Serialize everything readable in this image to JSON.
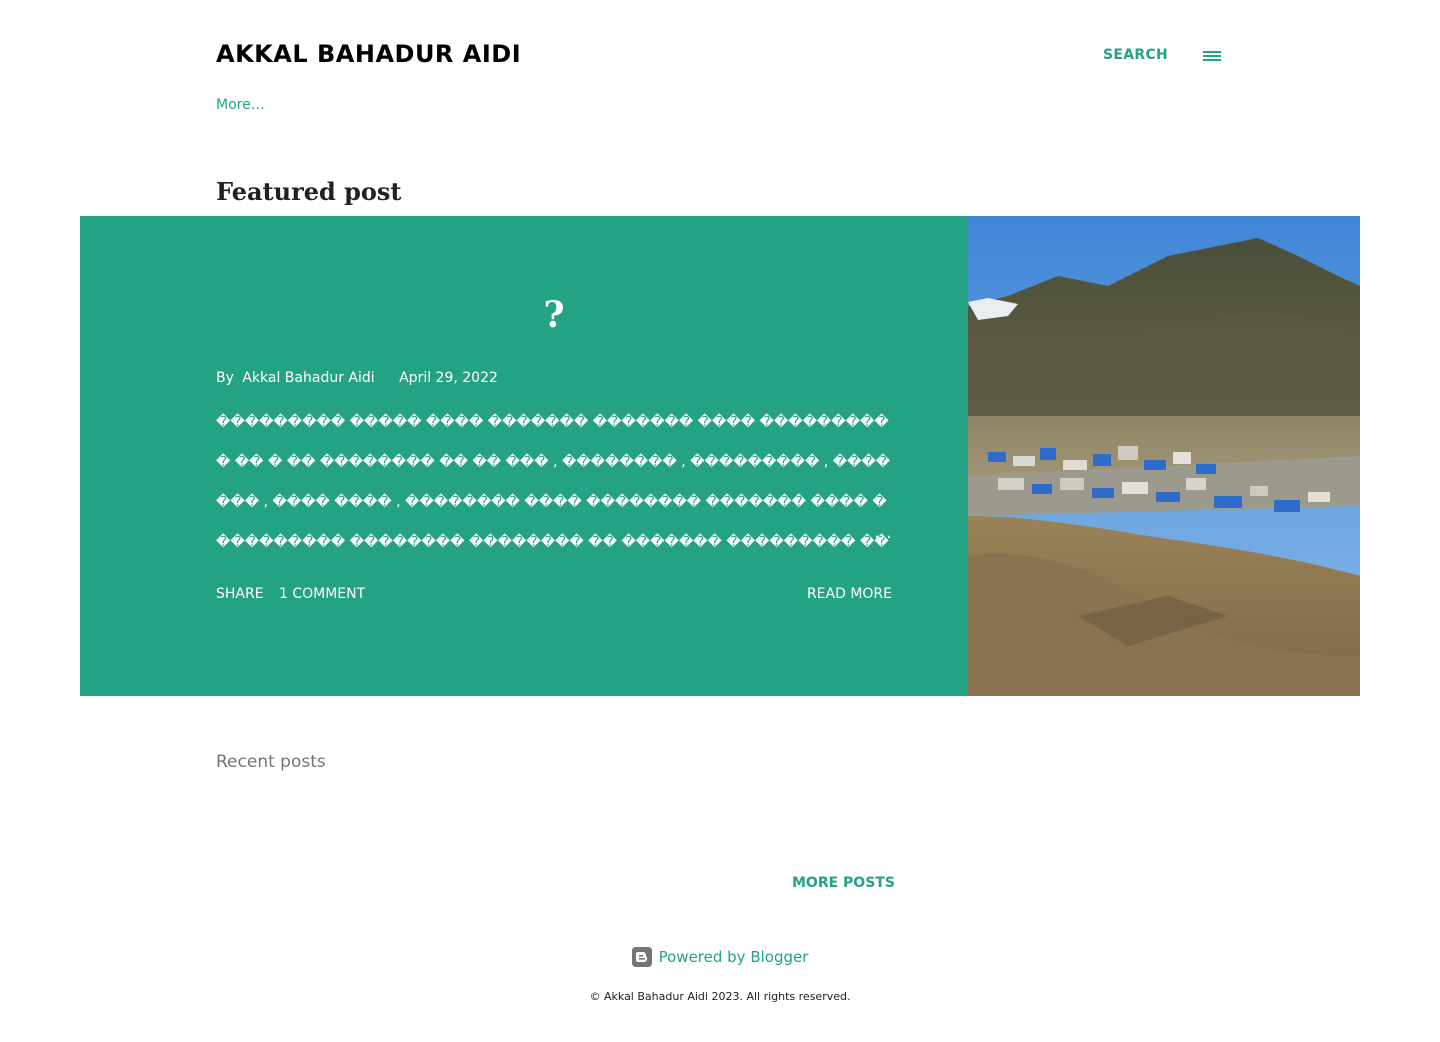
{
  "header": {
    "blog_title": "AKKAL BAHADUR AIDI",
    "search_label": "SEARCH",
    "menu_icon": "hamburger-menu-icon"
  },
  "nav": {
    "more_label": "More…"
  },
  "featured": {
    "section_heading": "Featured post",
    "post_title": "?",
    "byline_prefix": "By",
    "author": "Akkal Bahadur Aidi",
    "date": "April 29, 2022",
    "snippet": " ��������� ����� ���� ������� ������� ���� ���������� �� � �� �������� �� �� ��� , �������� , ��������� , ������� , ���� ���� , �������� ���� �������� ������� ���� ���������� �������� �������� �� ������� ��������� ���������� ����� ������� ����� ���� , ����� , �������� , ��������� ,",
    "ellipsis": "…",
    "share_label": "SHARE",
    "comments_label": "1 COMMENT",
    "read_more_label": "READ MORE",
    "image_alt": "mountain-village-photo"
  },
  "recent": {
    "heading": "Recent posts",
    "more_posts_label": "MORE POSTS"
  },
  "footer": {
    "powered_by": "Powered by Blogger",
    "copyright": "© Akkal Bahadur Aidi 2023. All rights reserved."
  },
  "colors": {
    "accent": "#24a384",
    "text": "#212121",
    "muted": "#757575"
  }
}
